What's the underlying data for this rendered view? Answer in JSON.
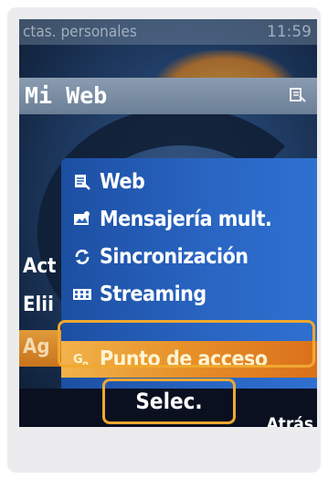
{
  "status": {
    "left_text": "ctas. personales",
    "time": "11:59"
  },
  "title": "Mi Web",
  "background_items": [
    "Act",
    "Elii",
    "Ag"
  ],
  "menu": {
    "items": [
      {
        "icon": "web-page-icon",
        "label": "Web"
      },
      {
        "icon": "mms-icon",
        "label": "Mensajería mult."
      },
      {
        "icon": "sync-icon",
        "label": "Sincronización"
      },
      {
        "icon": "streaming-icon",
        "label": "Streaming"
      },
      {
        "icon": "access-point-icon",
        "label": "Punto de acceso"
      }
    ],
    "selected_index": 4
  },
  "softkeys": {
    "left": "Selec.",
    "right": "Atrás"
  },
  "colors": {
    "menu_blue": "#2a66c4",
    "selected_orange": "#e8922a",
    "annotation_orange": "#f0a830"
  }
}
